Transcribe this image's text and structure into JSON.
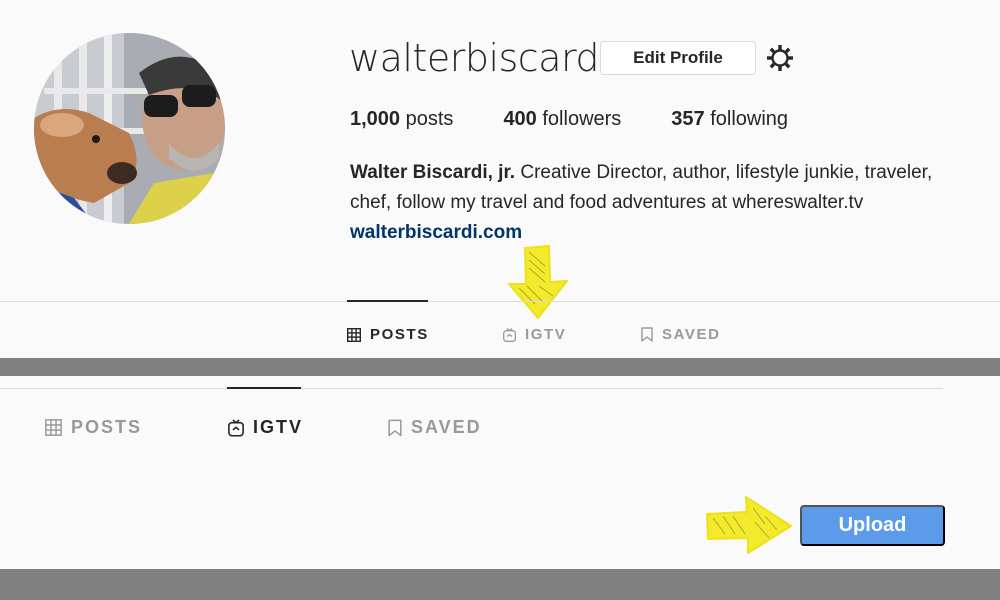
{
  "profile": {
    "username": "walterbiscardi",
    "edit_label": "Edit Profile",
    "stats": {
      "posts_count": "1,000",
      "posts_label": "posts",
      "followers_count": "400",
      "followers_label": "followers",
      "following_count": "357",
      "following_label": "following"
    },
    "bio": {
      "name": "Walter Biscardi, jr.",
      "line1": "Creative Director, author, lifestyle junkie, traveler,",
      "line2": "chef, follow my travel and food adventures at whereswalter.tv",
      "link": "walterbiscardi.com"
    }
  },
  "tabs_top": {
    "posts": "POSTS",
    "igtv": "IGTV",
    "saved": "SAVED",
    "active": "posts"
  },
  "tabs_bottom": {
    "posts": "POSTS",
    "igtv": "IGTV",
    "saved": "SAVED",
    "active": "igtv"
  },
  "upload_label": "Upload",
  "colors": {
    "arrow": "#f2ea2a",
    "upload": "#5b9bea",
    "link": "#003569",
    "band": "#808080"
  }
}
